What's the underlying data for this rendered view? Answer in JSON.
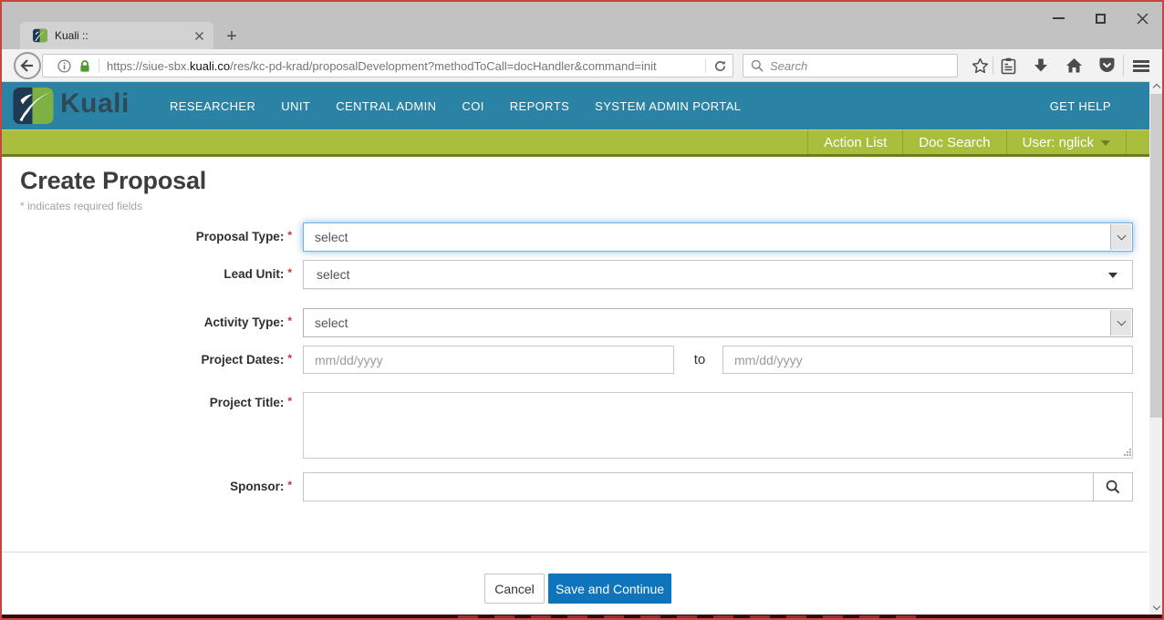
{
  "browser": {
    "tab_title": "Kuali ::",
    "new_tab_glyph": "+",
    "url_prefix": "https://siue-sbx.",
    "url_domain": "kuali.co",
    "url_path": "/res/kc-pd-krad/proposalDevelopment?methodToCall=docHandler&command=init",
    "search_placeholder": "Search"
  },
  "appbar": {
    "brand": "Kuali",
    "items": [
      "RESEARCHER",
      "UNIT",
      "CENTRAL ADMIN",
      "COI",
      "REPORTS",
      "SYSTEM ADMIN PORTAL"
    ],
    "help": "GET HELP"
  },
  "utilbar": {
    "action_list": "Action List",
    "doc_search": "Doc Search",
    "user": "User: nglick"
  },
  "page": {
    "title": "Create Proposal",
    "required_note": "* indicates required fields",
    "required_marker": "*"
  },
  "form": {
    "proposal_type": {
      "label": "Proposal Type:",
      "value": "select"
    },
    "lead_unit": {
      "label": "Lead Unit:",
      "value": "select"
    },
    "activity_type": {
      "label": "Activity Type:",
      "value": "select"
    },
    "project_dates": {
      "label": "Project Dates:",
      "start_placeholder": "mm/dd/yyyy",
      "to": "to",
      "end_placeholder": "mm/dd/yyyy"
    },
    "project_title": {
      "label": "Project Title:"
    },
    "sponsor": {
      "label": "Sponsor:"
    }
  },
  "actions": {
    "cancel": "Cancel",
    "save": "Save and Continue"
  },
  "colors": {
    "teal_header": "#2a83a4",
    "green_bar": "#a9be3c",
    "save_button_blue": "#0e74bc",
    "focus_glow_blue": "#6cb1e1",
    "required_red": "#cc3333",
    "lock_green": "#4e9a2e"
  }
}
